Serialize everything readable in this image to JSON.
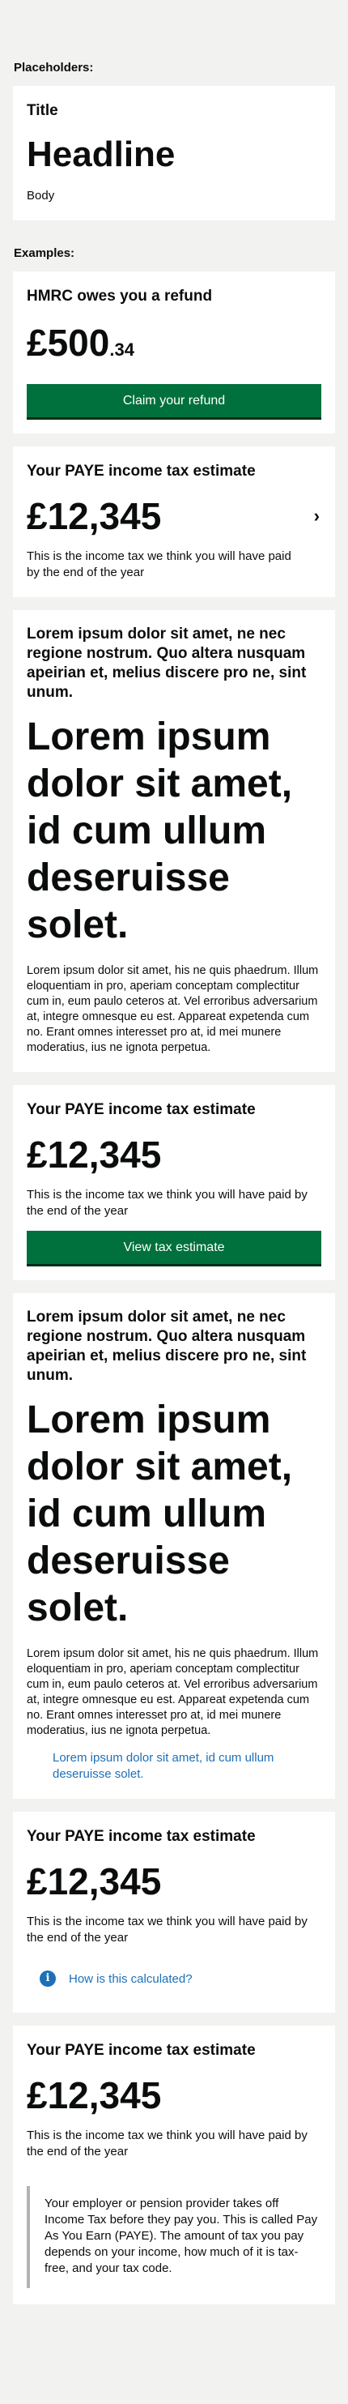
{
  "placeholders": {
    "label": "Placeholders:",
    "title": "Title",
    "headline": "Headline",
    "body": "Body"
  },
  "examples": {
    "label": "Examples:"
  },
  "refund": {
    "title": "HMRC owes you a refund",
    "amount_pounds": "£500",
    "amount_pence": ".34",
    "button": "Claim your refund"
  },
  "estimate1": {
    "title": "Your PAYE income tax estimate",
    "amount": "£12,345",
    "chevron": "›",
    "body": "This is the income tax we think you will have paid by the end of the year"
  },
  "lorem1": {
    "title": "Lorem ipsum dolor sit amet, ne nec regione nostrum. Quo altera nusquam apeirian et, melius discere pro ne, sint unum.",
    "headline": "Lorem ipsum dolor sit amet, id cum ullum deseruisse solet.",
    "body": "Lorem ipsum dolor sit amet, his ne quis phaedrum. Illum eloquentiam in pro, aperiam conceptam complectitur cum in, eum paulo ceteros at. Vel erroribus adversarium at, integre omnesque eu est. Appareat expetenda cum no. Erant omnes interesset pro at, id mei munere moderatius, ius ne ignota perpetua."
  },
  "estimate2": {
    "title": "Your PAYE income tax estimate",
    "amount": "£12,345",
    "body": "This is the income tax we think you will have paid by the end of the year",
    "button": "View tax estimate"
  },
  "lorem2": {
    "title": "Lorem ipsum dolor sit amet, ne nec regione nostrum. Quo altera nusquam apeirian et, melius discere pro ne, sint unum.",
    "headline": "Lorem ipsum dolor sit amet, id cum ullum deseruisse solet.",
    "body": "Lorem ipsum dolor sit amet, his ne quis phaedrum. Illum eloquentiam in pro, aperiam conceptam complectitur cum in, eum paulo ceteros at. Vel erroribus adversarium at, integre omnesque eu est. Appareat expetenda cum no. Erant omnes interesset pro at, id mei munere moderatius, ius ne ignota perpetua.",
    "link": "Lorem ipsum dolor sit amet, id cum ullum deseruisse solet."
  },
  "estimate3": {
    "title": "Your PAYE income tax estimate",
    "amount": "£12,345",
    "body": "This is the income tax we think you will have paid by the end of the year",
    "info_icon": "i",
    "info_link": "How is this calculated?"
  },
  "estimate4": {
    "title": "Your PAYE income tax estimate",
    "amount": "£12,345",
    "body": "This is the income tax we think you will have paid by the end of the year",
    "inset": "Your employer or pension provider takes off Income Tax before they pay you. This is called Pay As You Earn (PAYE). The amount of tax you pay depends on your income, how much of it is tax-free, and your tax code."
  },
  "colors": {
    "background": "#f2f2f0",
    "card": "#ffffff",
    "primary_button": "#00703c",
    "link": "#1d70b8",
    "inset_border": "#b1b4b6"
  }
}
